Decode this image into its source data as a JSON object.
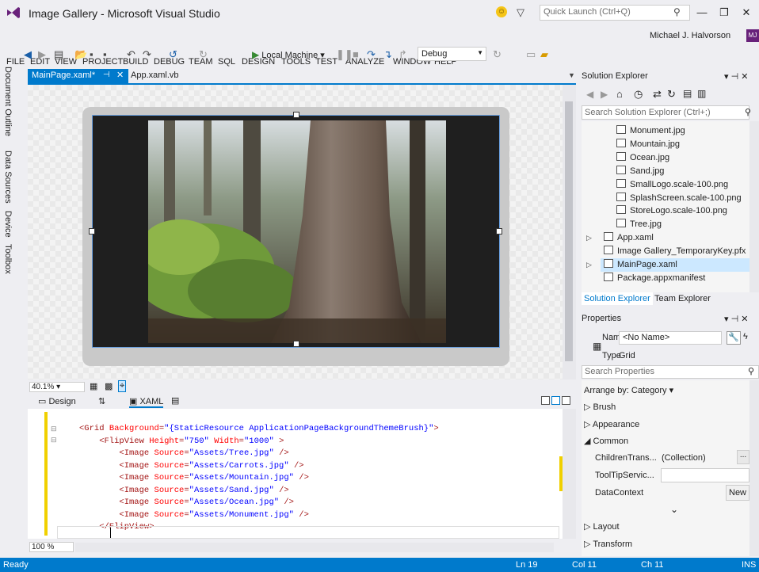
{
  "window": {
    "title": "Image Gallery - Microsoft Visual Studio",
    "quick_launch_placeholder": "Quick Launch (Ctrl+Q)",
    "user_name": "Michael J. Halvorson",
    "user_badge": "MJ"
  },
  "menu": [
    "FILE",
    "EDIT",
    "VIEW",
    "PROJECT",
    "BUILD",
    "DEBUG",
    "TEAM",
    "SQL",
    "DESIGN",
    "TOOLS",
    "TEST",
    "ANALYZE",
    "WINDOW",
    "HELP"
  ],
  "toolbar": {
    "run_target": "Local Machine",
    "configuration": "Debug"
  },
  "left_tabs": [
    "Document Outline",
    "Data Sources",
    "Device",
    "Toolbox"
  ],
  "doc_tabs": {
    "active": "MainPage.xaml*",
    "other": "App.xaml.vb"
  },
  "designer": {
    "zoom": "40.1%"
  },
  "view_tabs": {
    "design": "Design",
    "xaml": "XAML"
  },
  "code": [
    {
      "parts": [
        [
          "t",
          "<Grid "
        ],
        [
          "a",
          "Background"
        ],
        [
          "t",
          "="
        ],
        [
          "v",
          "\"{StaticResource ApplicationPageBackgroundThemeBrush}\""
        ],
        [
          "t",
          ">"
        ]
      ]
    },
    {
      "parts": [
        [
          "t",
          "    <FlipView "
        ],
        [
          "a",
          "Height"
        ],
        [
          "t",
          "="
        ],
        [
          "v",
          "\"750\""
        ],
        [
          "a",
          " Width"
        ],
        [
          "t",
          "="
        ],
        [
          "v",
          "\"1000\""
        ],
        [
          "t",
          " >"
        ]
      ]
    },
    {
      "parts": [
        [
          "t",
          "        <Image "
        ],
        [
          "a",
          "Source"
        ],
        [
          "t",
          "="
        ],
        [
          "v",
          "\"Assets/Tree.jpg\""
        ],
        [
          "t",
          " />"
        ]
      ]
    },
    {
      "parts": [
        [
          "t",
          "        <Image "
        ],
        [
          "a",
          "Source"
        ],
        [
          "t",
          "="
        ],
        [
          "v",
          "\"Assets/Carrots.jpg\""
        ],
        [
          "t",
          " />"
        ]
      ]
    },
    {
      "parts": [
        [
          "t",
          "        <Image "
        ],
        [
          "a",
          "Source"
        ],
        [
          "t",
          "="
        ],
        [
          "v",
          "\"Assets/Mountain.jpg\""
        ],
        [
          "t",
          " />"
        ]
      ]
    },
    {
      "parts": [
        [
          "t",
          "        <Image "
        ],
        [
          "a",
          "Source"
        ],
        [
          "t",
          "="
        ],
        [
          "v",
          "\"Assets/Sand.jpg\""
        ],
        [
          "t",
          " />"
        ]
      ]
    },
    {
      "parts": [
        [
          "t",
          "        <Image "
        ],
        [
          "a",
          "Source"
        ],
        [
          "t",
          "="
        ],
        [
          "v",
          "\"Assets/Ocean.jpg\""
        ],
        [
          "t",
          " />"
        ]
      ]
    },
    {
      "parts": [
        [
          "t",
          "        <Image "
        ],
        [
          "a",
          "Source"
        ],
        [
          "t",
          "="
        ],
        [
          "v",
          "\"Assets/Monument.jpg\""
        ],
        [
          "t",
          " />"
        ]
      ]
    },
    {
      "parts": [
        [
          "t",
          "    </FlipView>"
        ]
      ]
    }
  ],
  "editor": {
    "zoom": "100 %"
  },
  "solution_explorer": {
    "title": "Solution Explorer",
    "search_placeholder": "Search Solution Explorer (Ctrl+;)",
    "items": [
      {
        "label": "Monument.jpg",
        "kind": "image",
        "expandable": false
      },
      {
        "label": "Mountain.jpg",
        "kind": "image",
        "expandable": false
      },
      {
        "label": "Ocean.jpg",
        "kind": "image",
        "expandable": false
      },
      {
        "label": "Sand.jpg",
        "kind": "image",
        "expandable": false
      },
      {
        "label": "SmallLogo.scale-100.png",
        "kind": "image",
        "expandable": false
      },
      {
        "label": "SplashScreen.scale-100.png",
        "kind": "image",
        "expandable": false
      },
      {
        "label": "StoreLogo.scale-100.png",
        "kind": "image",
        "expandable": false
      },
      {
        "label": "Tree.jpg",
        "kind": "image",
        "expandable": false
      },
      {
        "label": "App.xaml",
        "kind": "xaml",
        "expandable": true
      },
      {
        "label": "Image Gallery_TemporaryKey.pfx",
        "kind": "key",
        "expandable": false
      },
      {
        "label": "MainPage.xaml",
        "kind": "xaml",
        "expandable": true
      },
      {
        "label": "Package.appxmanifest",
        "kind": "manifest",
        "expandable": false
      }
    ],
    "tab_se": "Solution Explorer",
    "tab_te": "Team Explorer"
  },
  "properties": {
    "title": "Properties",
    "name_label": "Name",
    "name_value": "<No Name>",
    "type_label": "Type",
    "type_value": "Grid",
    "search_placeholder": "Search Properties",
    "arrange_by": "Arrange by: Category",
    "cat_brush": "Brush",
    "cat_appearance": "Appearance",
    "cat_common": "Common",
    "prop_children": "ChildrenTrans...",
    "prop_children_value": "(Collection)",
    "prop_tooltip": "ToolTipServic...",
    "prop_datacontext": "DataContext",
    "new_button": "New",
    "cat_layout": "Layout",
    "cat_transform": "Transform"
  },
  "status": {
    "state": "Ready",
    "line": "Ln 19",
    "col": "Col 11",
    "ch": "Ch 11",
    "mode": "INS"
  },
  "colors": {
    "accent": "#007acc",
    "code_tag": "#a31515",
    "code_attr": "#ff0000",
    "code_value": "#0000ff",
    "change_marker": "#f0d000"
  }
}
